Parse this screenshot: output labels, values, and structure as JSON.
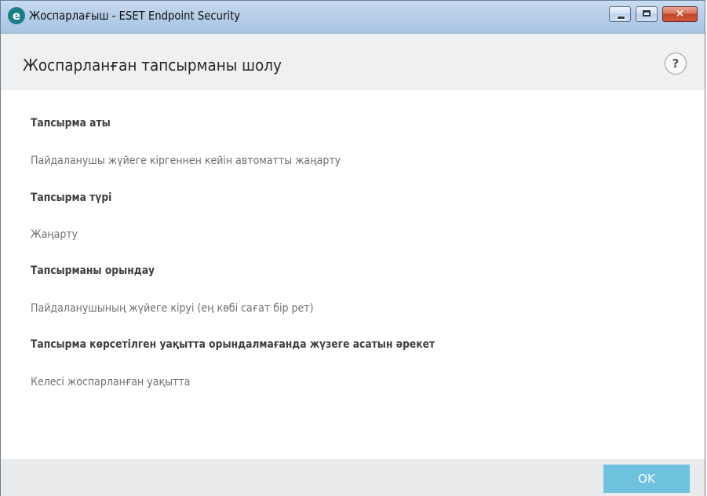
{
  "window": {
    "title": "Жоспарлағыш - ESET Endpoint Security",
    "logo_letter": "e",
    "close_glyph": "✕",
    "logo_icon": "eset-logo-icon"
  },
  "header": {
    "title": "Жоспарланған тапсырманы шолу",
    "help_glyph": "?"
  },
  "fields": [
    {
      "label": "Тапсырма аты",
      "value": "Пайдаланушы жүйеге кіргеннен кейін автоматты жаңарту"
    },
    {
      "label": "Тапсырма түрі",
      "value": "Жаңарту"
    },
    {
      "label": "Тапсырманы орындау",
      "value": "Пайдаланушының жүйеге кіруі (ең көбі сағат бір рет)"
    },
    {
      "label": "Тапсырма көрсетілген уақытта орындалмағанда жүзеге асатын әрекет",
      "value": "Келесі жоспарланған уақытта"
    }
  ],
  "footer": {
    "ok_label": "OK"
  },
  "colors": {
    "accent": "#6fc2dd",
    "header_bg": "#eef0f1",
    "logo": "#1c7d85"
  }
}
